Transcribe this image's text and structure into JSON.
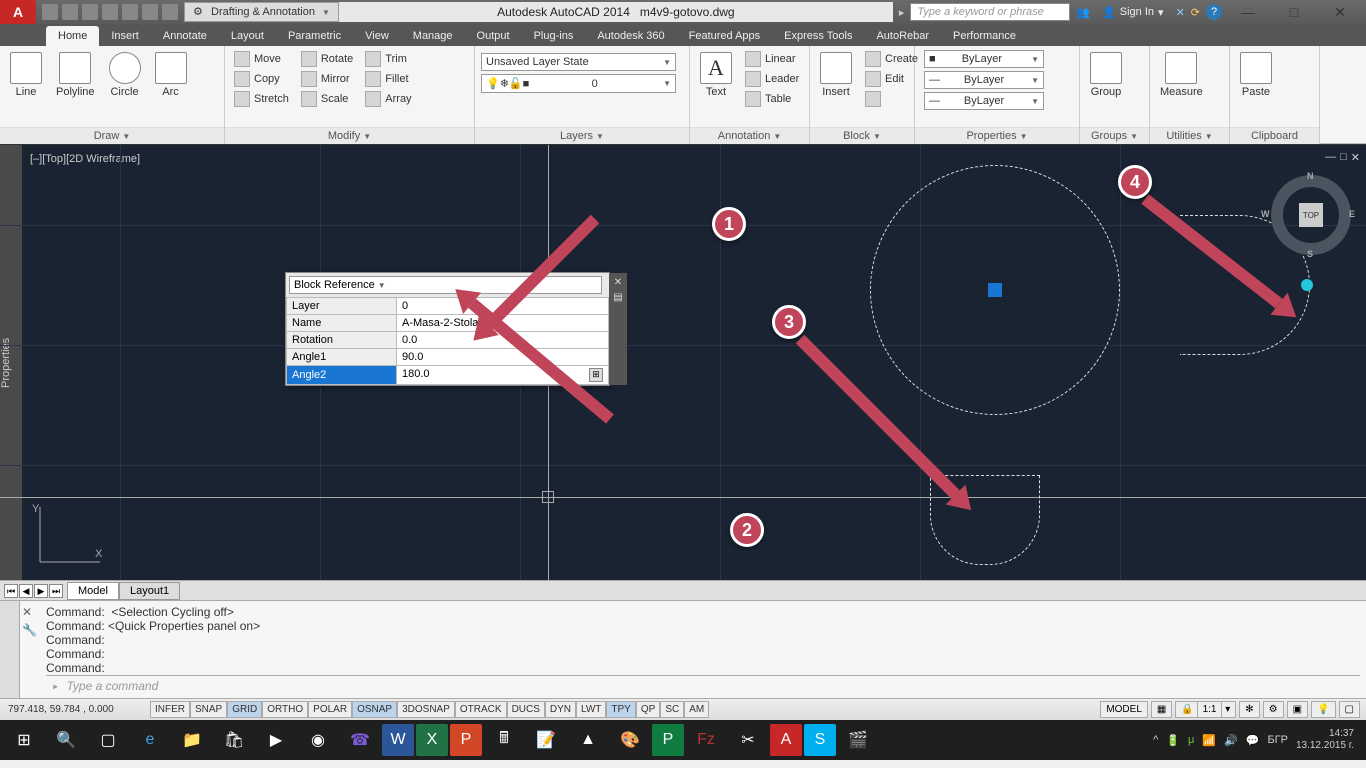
{
  "titlebar": {
    "workspace": "Drafting & Annotation",
    "app": "Autodesk AutoCAD 2014",
    "file": "m4v9-gotovo.dwg",
    "search_placeholder": "Type a keyword or phrase",
    "signin": "Sign In"
  },
  "tabs": [
    "Home",
    "Insert",
    "Annotate",
    "Layout",
    "Parametric",
    "View",
    "Manage",
    "Output",
    "Plug-ins",
    "Autodesk 360",
    "Featured Apps",
    "Express Tools",
    "AutoRebar",
    "Performance"
  ],
  "ribbon": {
    "draw": {
      "title": "Draw",
      "btns": [
        "Line",
        "Polyline",
        "Circle",
        "Arc"
      ]
    },
    "modify": {
      "title": "Modify",
      "items": [
        "Move",
        "Copy",
        "Stretch",
        "Rotate",
        "Mirror",
        "Scale",
        "Trim",
        "Fillet",
        "Array"
      ]
    },
    "layers": {
      "title": "Layers",
      "state": "Unsaved Layer State",
      "current": "0"
    },
    "annotation": {
      "title": "Annotation",
      "text": "Text",
      "items": [
        "Linear",
        "Leader",
        "Table"
      ]
    },
    "block": {
      "title": "Block",
      "insert": "Insert",
      "items": [
        "Create",
        "Edit"
      ]
    },
    "properties": {
      "title": "Properties",
      "bylayer": "ByLayer"
    },
    "groups": {
      "title": "Groups",
      "btn": "Group"
    },
    "utilities": {
      "title": "Utilities",
      "btn": "Measure"
    },
    "clipboard": {
      "title": "Clipboard",
      "btn": "Paste"
    }
  },
  "viewport": {
    "label": "[–][Top][2D Wireframe]",
    "viewcube": {
      "top": "TOP",
      "n": "N",
      "s": "S",
      "e": "E",
      "w": "W"
    }
  },
  "qprops": {
    "title": "Block Reference",
    "rows": [
      {
        "k": "Layer",
        "v": "0"
      },
      {
        "k": "Name",
        "v": "A-Masa-2-Stola"
      },
      {
        "k": "Rotation",
        "v": "0.0"
      },
      {
        "k": "Angle1",
        "v": "90.0"
      },
      {
        "k": "Angle2",
        "v": "180.0"
      }
    ]
  },
  "callouts": [
    "1",
    "2",
    "3",
    "4"
  ],
  "layouttabs": {
    "model": "Model",
    "layout1": "Layout1"
  },
  "cmd": {
    "lines": [
      "Command:  <Selection Cycling off>",
      "Command: <Quick Properties panel on>",
      "Command:",
      "Command:",
      "Command:"
    ],
    "prompt": "Type a command"
  },
  "status": {
    "coords": "797.418, 59.784 , 0.000",
    "toggles": [
      "INFER",
      "SNAP",
      "GRID",
      "ORTHO",
      "POLAR",
      "OSNAP",
      "3DOSNAP",
      "OTRACK",
      "DUCS",
      "DYN",
      "LWT",
      "TPY",
      "QP",
      "SC",
      "AM"
    ],
    "toggles_on": [
      "GRID",
      "OSNAP",
      "TPY"
    ],
    "model": "MODEL",
    "scale": "1:1"
  },
  "clock": {
    "time": "14:37",
    "date": "13.12.2015 г."
  },
  "lang": "БГР",
  "properties_side": "Properties"
}
